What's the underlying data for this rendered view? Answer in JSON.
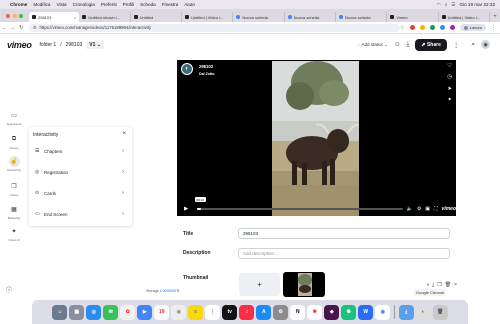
{
  "menubar": {
    "items": [
      "Chrome",
      "Modifica",
      "Vista",
      "Cronologia",
      "Preferiti",
      "Profili",
      "Scheda",
      "Finestra",
      "Aiuto"
    ],
    "clock": "Gio 19 mar 22:32"
  },
  "tabs": [
    {
      "label": "298103"
    },
    {
      "label": "Untitled shown i..."
    },
    {
      "label": "Untitled"
    },
    {
      "label": "Untitled | Video i..."
    },
    {
      "label": "Nuova scheda"
    },
    {
      "label": "Nuova scheda"
    },
    {
      "label": "Nuova scheda"
    },
    {
      "label": "Vimeo"
    },
    {
      "label": "Untitled | Video i..."
    }
  ],
  "address": {
    "url": "https://vimeo.com/manage/videos/1175189994/interactivity",
    "profile_label": "Lavoro"
  },
  "header": {
    "logo": "vimeo",
    "breadcrumb_folder": "folder 1",
    "breadcrumb_sep": "/",
    "breadcrumb_video": "298103",
    "version": "V1",
    "add_status": "Add status",
    "share": "Share"
  },
  "rail": [
    {
      "label": "Appearance",
      "icon": "play-window-icon"
    },
    {
      "label": "Cameo",
      "icon": "cameo-icon"
    },
    {
      "label": "Interactivity",
      "icon": "hand-pointer-icon",
      "selected": true
    },
    {
      "label": "Library",
      "icon": "library-icon"
    },
    {
      "label": "Marketing",
      "icon": "marketing-icon"
    },
    {
      "label": "Vimeo AI",
      "icon": "sparkle-icon"
    }
  ],
  "panel": {
    "title": "Interactivity",
    "items": [
      {
        "label": "Chapters"
      },
      {
        "label": "Registration"
      },
      {
        "label": "Cards"
      },
      {
        "label": "End Screen"
      }
    ]
  },
  "player": {
    "title": "298103",
    "subtitle": "Dal Zotto",
    "time": "00:12",
    "progress": 0.02,
    "brand": "vimeo"
  },
  "form": {
    "title_label": "Title",
    "title_value": "298103",
    "description_label": "Description",
    "description_placeholder": "Add description...",
    "thumbnail_label": "Thumbnail",
    "thumbnail_add": "+"
  },
  "storage": {
    "label": "Storage",
    "value": "1.00GB/5TB"
  },
  "tooltip": "Google Chrome",
  "colors": {
    "brand_dark": "#17191e",
    "accent_blue": "#1a74e8"
  }
}
